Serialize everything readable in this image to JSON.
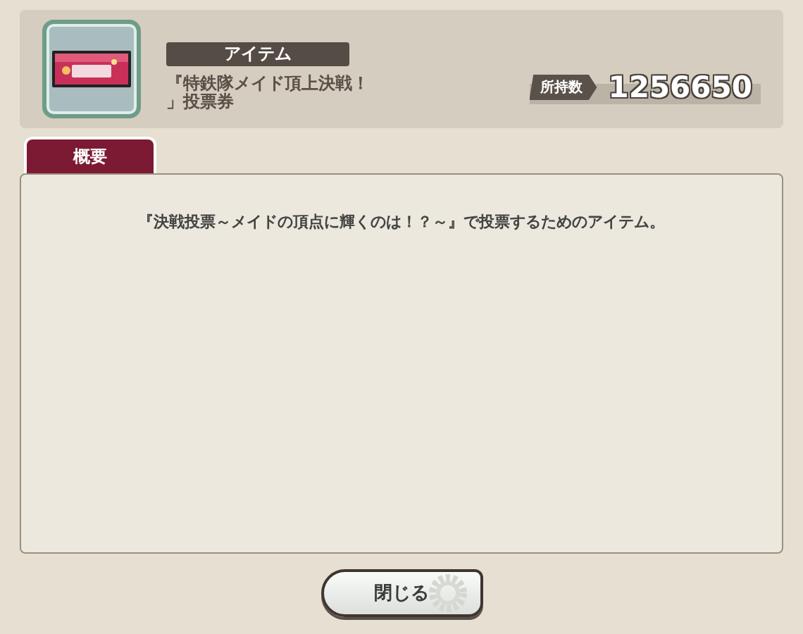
{
  "item": {
    "category": "アイテム",
    "name": "『特鉄隊メイド頂上決戦！」投票券",
    "owned_label": "所持数",
    "owned_count": "1256650"
  },
  "tabs": [
    {
      "label": "概要",
      "selected": true
    }
  ],
  "description": "『決戦投票～メイドの頂点に輝くのは！？～』で投票するためのアイテム。",
  "buttons": [
    "閉じる"
  ]
}
